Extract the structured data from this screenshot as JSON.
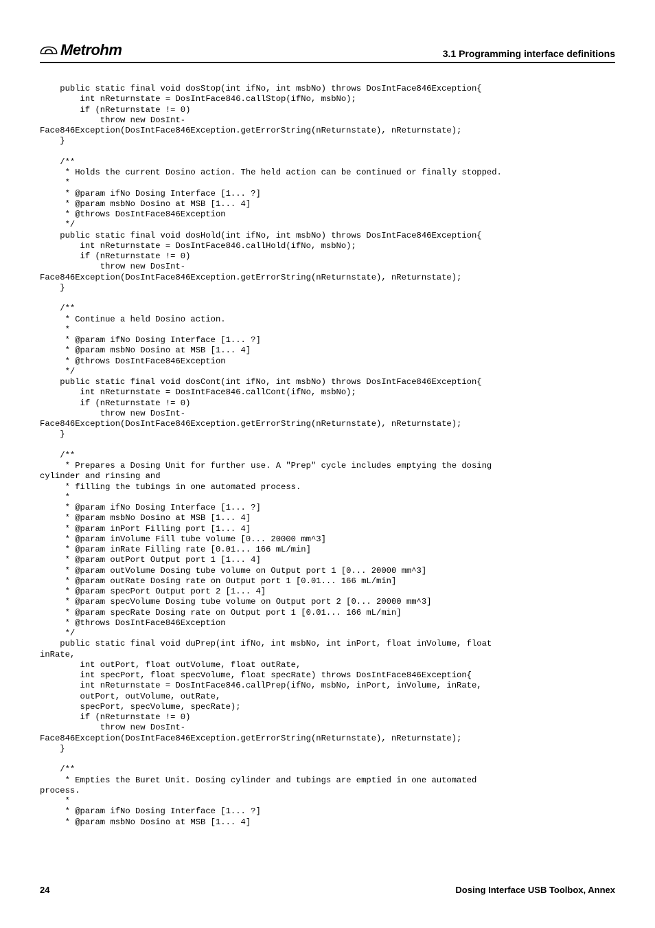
{
  "header": {
    "brand": "Metrohm",
    "section": "3.1 Programming interface definitions"
  },
  "code": "    public static final void dosStop(int ifNo, int msbNo) throws DosIntFace846Exception{\n        int nReturnstate = DosIntFace846.callStop(ifNo, msbNo);\n        if (nReturnstate != 0)\n            throw new DosInt-\nFace846Exception(DosIntFace846Exception.getErrorString(nReturnstate), nReturnstate);\n    }\n\n    /**\n     * Holds the current Dosino action. The held action can be continued or finally stopped.\n     *\n     * @param ifNo Dosing Interface [1... ?]\n     * @param msbNo Dosino at MSB [1... 4]\n     * @throws DosIntFace846Exception\n     */\n    public static final void dosHold(int ifNo, int msbNo) throws DosIntFace846Exception{\n        int nReturnstate = DosIntFace846.callHold(ifNo, msbNo);\n        if (nReturnstate != 0)\n            throw new DosInt-\nFace846Exception(DosIntFace846Exception.getErrorString(nReturnstate), nReturnstate);\n    }\n\n    /**\n     * Continue a held Dosino action.\n     *\n     * @param ifNo Dosing Interface [1... ?]\n     * @param msbNo Dosino at MSB [1... 4]\n     * @throws DosIntFace846Exception\n     */\n    public static final void dosCont(int ifNo, int msbNo) throws DosIntFace846Exception{\n        int nReturnstate = DosIntFace846.callCont(ifNo, msbNo);\n        if (nReturnstate != 0)\n            throw new DosInt-\nFace846Exception(DosIntFace846Exception.getErrorString(nReturnstate), nReturnstate);\n    }\n\n    /**\n     * Prepares a Dosing Unit for further use. A \"Prep\" cycle includes emptying the dosing\ncylinder and rinsing and\n     * filling the tubings in one automated process.\n     *\n     * @param ifNo Dosing Interface [1... ?]\n     * @param msbNo Dosino at MSB [1... 4]\n     * @param inPort Filling port [1... 4]\n     * @param inVolume Fill tube volume [0... 20000 mm^3]\n     * @param inRate Filling rate [0.01... 166 mL/min]\n     * @param outPort Output port 1 [1... 4]\n     * @param outVolume Dosing tube volume on Output port 1 [0... 20000 mm^3]\n     * @param outRate Dosing rate on Output port 1 [0.01... 166 mL/min]\n     * @param specPort Output port 2 [1... 4]\n     * @param specVolume Dosing tube volume on Output port 2 [0... 20000 mm^3]\n     * @param specRate Dosing rate on Output port 1 [0.01... 166 mL/min]\n     * @throws DosIntFace846Exception\n     */\n    public static final void duPrep(int ifNo, int msbNo, int inPort, float inVolume, float\ninRate,\n        int outPort, float outVolume, float outRate,\n        int specPort, float specVolume, float specRate) throws DosIntFace846Exception{\n        int nReturnstate = DosIntFace846.callPrep(ifNo, msbNo, inPort, inVolume, inRate,\n        outPort, outVolume, outRate,\n        specPort, specVolume, specRate);\n        if (nReturnstate != 0)\n            throw new DosInt-\nFace846Exception(DosIntFace846Exception.getErrorString(nReturnstate), nReturnstate);\n    }\n\n    /**\n     * Empties the Buret Unit. Dosing cylinder and tubings are emptied in one automated\nprocess.\n     *\n     * @param ifNo Dosing Interface [1... ?]\n     * @param msbNo Dosino at MSB [1... 4]",
  "footer": {
    "page": "24",
    "title": "Dosing Interface USB Toolbox, Annex"
  }
}
